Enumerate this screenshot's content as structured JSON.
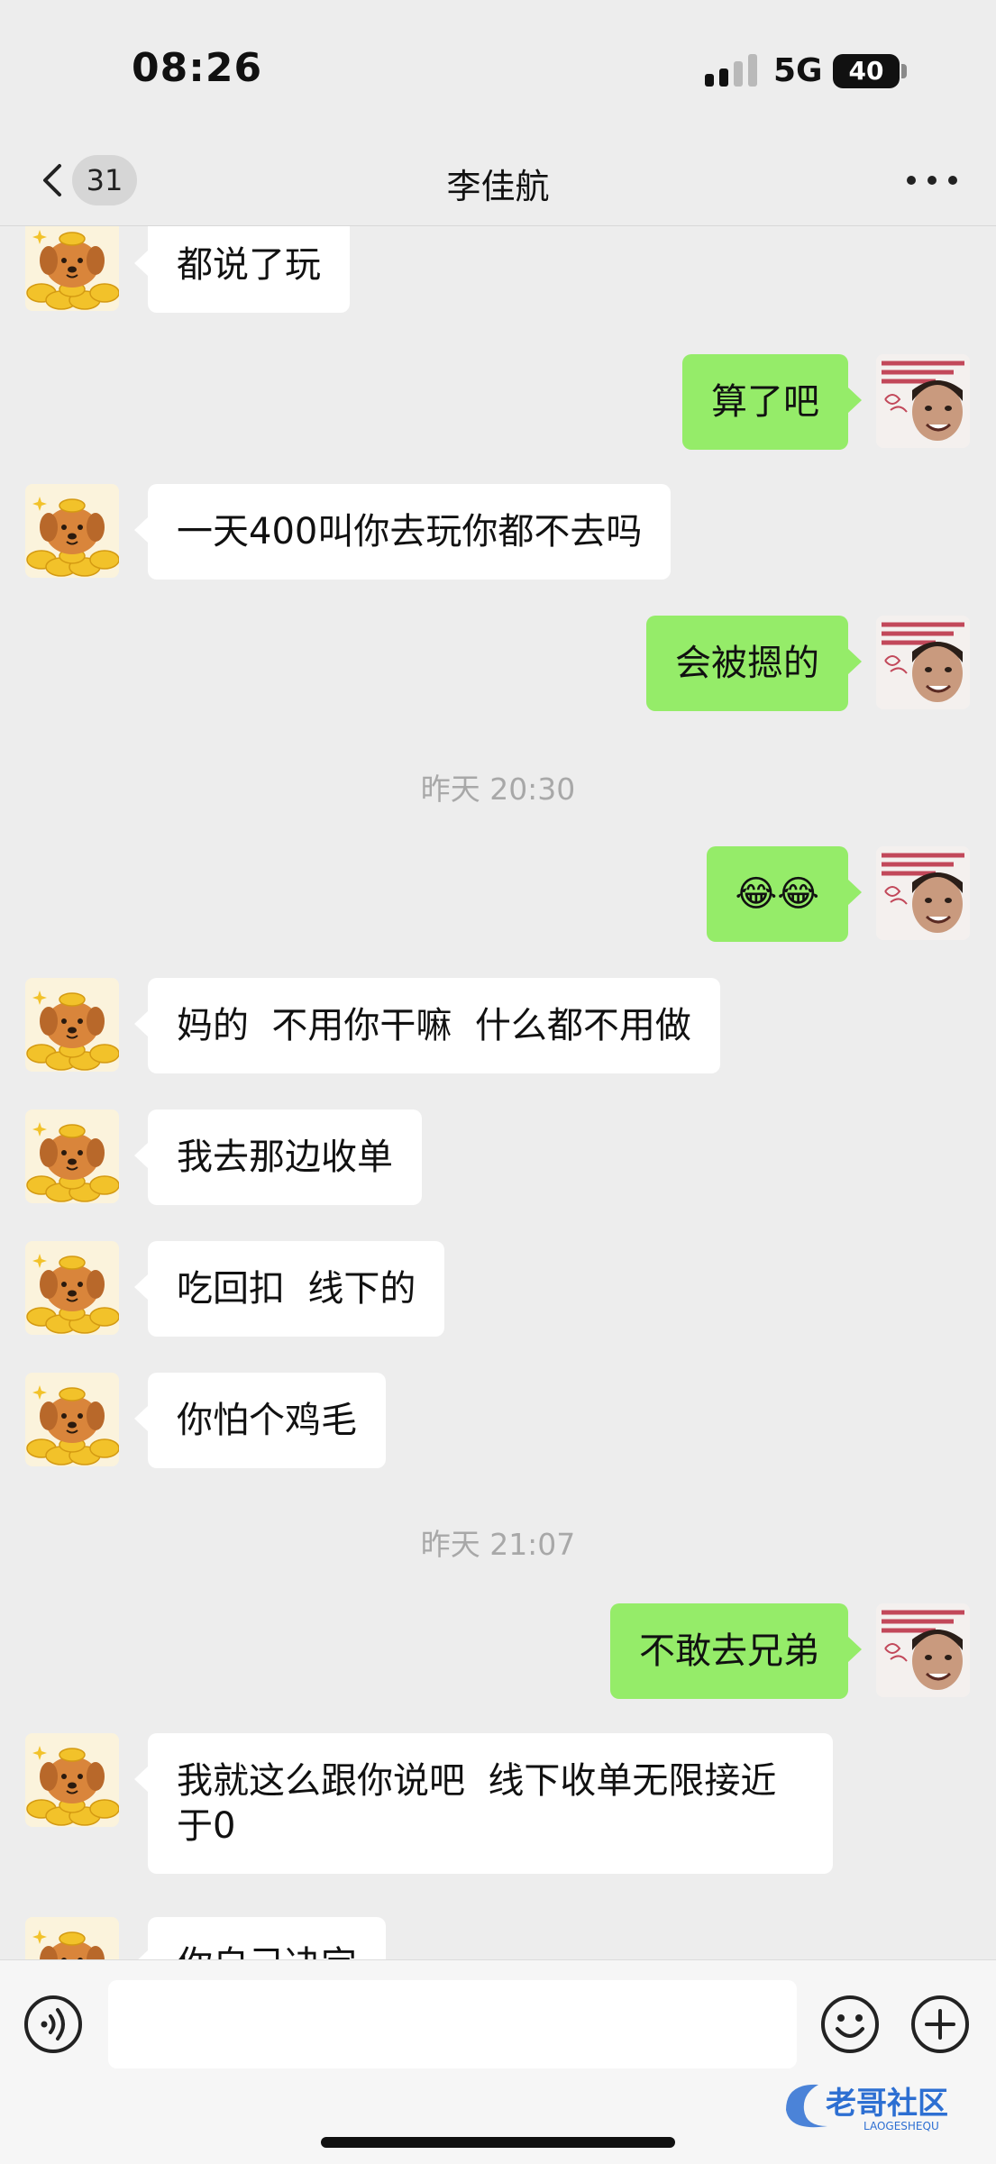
{
  "status_bar": {
    "time": "08:26",
    "network": "5G",
    "battery": "40",
    "signal_bars_active": 2,
    "signal_bars_total": 4
  },
  "nav": {
    "unread_count": "31",
    "title": "李佳航"
  },
  "messages": [
    {
      "side": "left",
      "type": "text",
      "text": "都说了玩"
    },
    {
      "side": "right",
      "type": "text",
      "text": "算了吧"
    },
    {
      "side": "left",
      "type": "text",
      "text": "一天400叫你去玩你都不去吗"
    },
    {
      "side": "right",
      "type": "text",
      "text": "会被摁的"
    },
    {
      "type": "time",
      "text": "昨天 20:30"
    },
    {
      "side": "right",
      "type": "text",
      "text": "😂😂"
    },
    {
      "side": "left",
      "type": "text",
      "text": "妈的  不用你干嘛  什么都不用做"
    },
    {
      "side": "left",
      "type": "text",
      "text": "我去那边收单"
    },
    {
      "side": "left",
      "type": "text",
      "text": "吃回扣  线下的"
    },
    {
      "side": "left",
      "type": "text",
      "text": "你怕个鸡毛"
    },
    {
      "type": "time",
      "text": "昨天 21:07"
    },
    {
      "side": "right",
      "type": "text",
      "text": "不敢去兄弟"
    },
    {
      "side": "left",
      "type": "text",
      "text": "我就这么跟你说吧  线下收单无限接近于0"
    },
    {
      "side": "left",
      "type": "text",
      "text": "你自己决定"
    }
  ],
  "avatars": {
    "contact": {
      "icon": "dog-on-gold-coins",
      "bg": "#fbf3dc",
      "color": "#d9853b"
    },
    "self": {
      "icon": "meme-face-sticker",
      "bg": "#f4f0ee"
    }
  },
  "input_bar": {
    "input_value": ""
  },
  "watermark": {
    "text": "老哥社区",
    "sub": "LAOGESHEQU",
    "color": "#2d6fd2"
  },
  "colors": {
    "background": "#ededed",
    "self_bubble": "#95ec69",
    "other_bubble": "#ffffff",
    "timestamp": "#a8a8a8"
  }
}
